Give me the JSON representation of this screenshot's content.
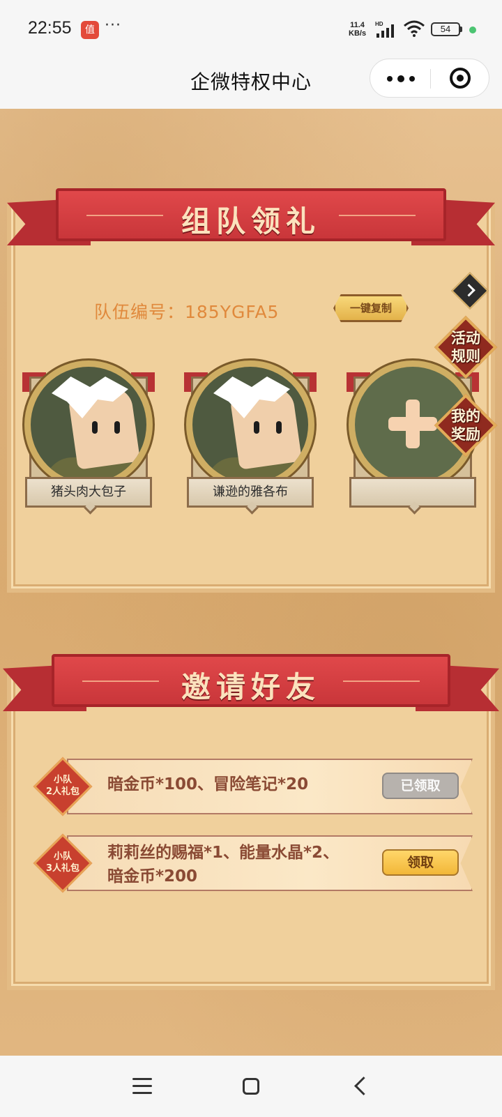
{
  "status_bar": {
    "time": "22:55",
    "notification_icon_text": "值",
    "more": "···",
    "net_speed_top": "11.4",
    "net_speed_bottom": "KB/s",
    "signal_label": "HD",
    "battery": "54"
  },
  "header": {
    "title": "企微特权中心"
  },
  "team_section": {
    "banner": "组队领礼",
    "team_id_label": "队伍编号：185YGFA5",
    "copy_button": "一键复制",
    "side_buttons": {
      "rules": "活动\n规则",
      "rewards": "我的\n奖励"
    },
    "members": [
      {
        "name": "猪头肉大包子"
      },
      {
        "name": "谦逊的雅各布"
      },
      {
        "name": ""
      }
    ]
  },
  "invite_section": {
    "banner": "邀请好友",
    "rewards": [
      {
        "badge": "小队\n2人礼包",
        "description": "暗金币*100、冒险笔记*20",
        "button": "已领取",
        "state": "claimed"
      },
      {
        "badge": "小队\n3人礼包",
        "description_line1": "莉莉丝的赐福*1、能量水晶*2、",
        "description_line2": "暗金币*200",
        "button": "领取",
        "state": "available"
      }
    ]
  },
  "colors": {
    "ribbon": "#c9363a",
    "parchment": "#e7c191",
    "team_id_text": "#e0893c",
    "claim_button": "#f2b738"
  }
}
